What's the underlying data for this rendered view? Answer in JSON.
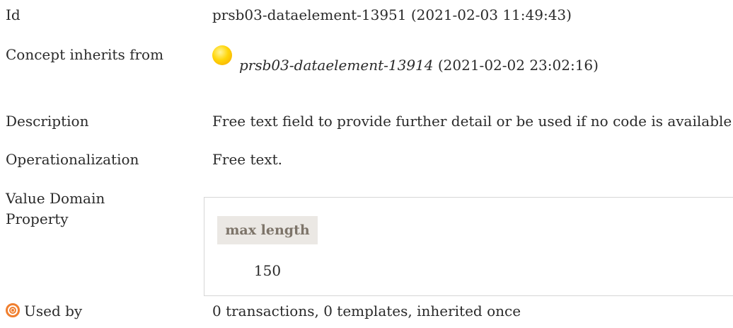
{
  "fields": {
    "id": {
      "label": "Id",
      "value": "prsb03-dataelement-13951 (2021-02-03 11:49:43)"
    },
    "inherits": {
      "label": "Concept inherits from",
      "ref_id": "prsb03-dataelement-13914",
      "ref_date": " (2021-02-02 23:02:16)",
      "icon": "status-sun-icon"
    },
    "description": {
      "label": "Description",
      "value": "Free text field to provide further detail or be used if no code is available."
    },
    "operationalization": {
      "label": "Operationalization",
      "value": "Free text."
    },
    "value_domain": {
      "label": "Value Domain"
    },
    "property": {
      "label": "Property",
      "header": "max length",
      "value": "150"
    },
    "used_by": {
      "label": "Used by",
      "icon": "target-icon",
      "value": "0 transactions, 0 templates, inherited once"
    }
  },
  "colors": {
    "text": "#2a2a2a",
    "property_header_bg": "#ebe8e4",
    "property_header_text": "#7d7469",
    "target_icon": "#f07f2f",
    "sun_icon": "#ffd60a"
  }
}
